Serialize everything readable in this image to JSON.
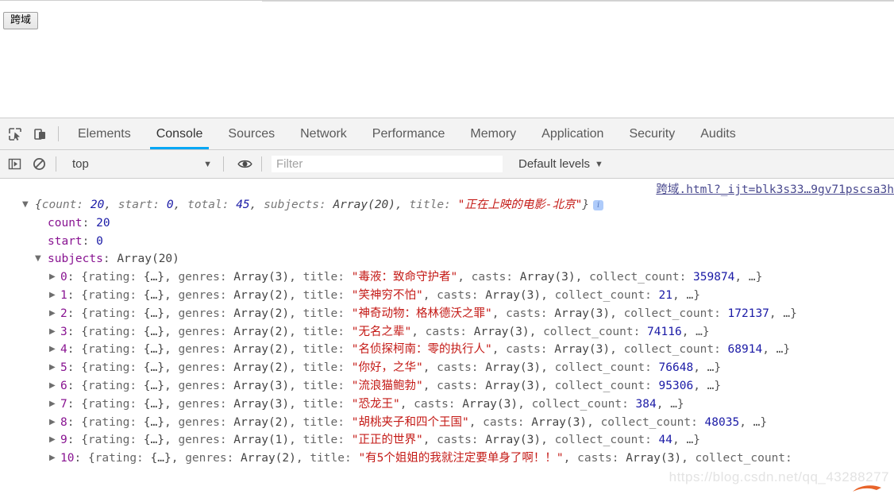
{
  "page": {
    "cors_button_label": "跨域"
  },
  "devtools": {
    "toolbar_icons": [
      {
        "name": "inspect-element-icon"
      },
      {
        "name": "device-toolbar-icon"
      }
    ],
    "tabs": [
      {
        "label": "Elements",
        "selected": false
      },
      {
        "label": "Console",
        "selected": true
      },
      {
        "label": "Sources",
        "selected": false
      },
      {
        "label": "Network",
        "selected": false
      },
      {
        "label": "Performance",
        "selected": false
      },
      {
        "label": "Memory",
        "selected": false
      },
      {
        "label": "Application",
        "selected": false
      },
      {
        "label": "Security",
        "selected": false
      },
      {
        "label": "Audits",
        "selected": false
      }
    ],
    "filterbar": {
      "sidebar_toggle_icon": "console-sidebar-icon",
      "clear_icon": "clear-console-icon",
      "context_value": "top",
      "caret": "▼",
      "eye_icon": "live-expression-eye-icon",
      "filter_placeholder": "Filter",
      "filter_value": "",
      "levels_label": "Default levels",
      "levels_caret": "▼"
    },
    "accent_color": "#06a7f5"
  },
  "console": {
    "source_link": "跨域.html?_ijt=blk3s33…9gv71pscsa3h",
    "root_preview": {
      "triangle": "▼",
      "text_open": "{",
      "entries": [
        {
          "key": "count",
          "sep": ": ",
          "value": "20",
          "kind": "num",
          "after": ", "
        },
        {
          "key": "start",
          "sep": ": ",
          "value": "0",
          "kind": "num",
          "after": ", "
        },
        {
          "key": "total",
          "sep": ": ",
          "value": "45",
          "kind": "num",
          "after": ", "
        },
        {
          "key": "subjects",
          "sep": ": ",
          "value": "Array(20)",
          "kind": "plain",
          "after": ", "
        },
        {
          "key": "title",
          "sep": ": ",
          "value": "\"正在上映的电影-北京\"",
          "kind": "str",
          "after": ""
        }
      ],
      "text_close": "}",
      "badge": "i"
    },
    "properties": [
      {
        "triangle": "",
        "key": "count",
        "value": "20",
        "kind": "num"
      },
      {
        "triangle": "",
        "key": "start",
        "value": "0",
        "kind": "num"
      },
      {
        "triangle": "▼",
        "key": "subjects",
        "value": "Array(20)",
        "kind": "plain"
      }
    ],
    "array_items": [
      {
        "index": "0",
        "rating": "{…}",
        "genres": "Array(3)",
        "title": "\"毒液：致命守护者\"",
        "casts": "Array(3)",
        "collect_count": "359874",
        "tail": ", …}"
      },
      {
        "index": "1",
        "rating": "{…}",
        "genres": "Array(2)",
        "title": "\"笑神穷不怕\"",
        "casts": "Array(3)",
        "collect_count": "21",
        "tail": ", …}"
      },
      {
        "index": "2",
        "rating": "{…}",
        "genres": "Array(2)",
        "title": "\"神奇动物：格林德沃之罪\"",
        "casts": "Array(3)",
        "collect_count": "172137",
        "tail": ", …}"
      },
      {
        "index": "3",
        "rating": "{…}",
        "genres": "Array(2)",
        "title": "\"无名之辈\"",
        "casts": "Array(3)",
        "collect_count": "74116",
        "tail": ", …}"
      },
      {
        "index": "4",
        "rating": "{…}",
        "genres": "Array(2)",
        "title": "\"名侦探柯南：零的执行人\"",
        "casts": "Array(3)",
        "collect_count": "68914",
        "tail": ", …}"
      },
      {
        "index": "5",
        "rating": "{…}",
        "genres": "Array(2)",
        "title": "\"你好，之华\"",
        "casts": "Array(3)",
        "collect_count": "76648",
        "tail": ", …}"
      },
      {
        "index": "6",
        "rating": "{…}",
        "genres": "Array(3)",
        "title": "\"流浪猫鲍勃\"",
        "casts": "Array(3)",
        "collect_count": "95306",
        "tail": ", …}"
      },
      {
        "index": "7",
        "rating": "{…}",
        "genres": "Array(3)",
        "title": "\"恐龙王\"",
        "casts": "Array(3)",
        "collect_count": "384",
        "tail": ", …}"
      },
      {
        "index": "8",
        "rating": "{…}",
        "genres": "Array(2)",
        "title": "\"胡桃夹子和四个王国\"",
        "casts": "Array(3)",
        "collect_count": "48035",
        "tail": ", …}"
      },
      {
        "index": "9",
        "rating": "{…}",
        "genres": "Array(1)",
        "title": "\"正正的世界\"",
        "casts": "Array(3)",
        "collect_count": "44",
        "tail": ", …}"
      },
      {
        "index": "10",
        "rating": "{…}",
        "genres": "Array(2)",
        "title": "\"有5个姐姐的我就注定要单身了啊！！\"",
        "casts": "Array(3)",
        "collect_count": "",
        "tail": ""
      }
    ],
    "labels": {
      "rating_key": "rating",
      "genres_key": "genres",
      "title_key": "title",
      "casts_key": "casts",
      "collect_key": "collect_count",
      "collapsed_triangle": "▶"
    }
  },
  "watermark": {
    "text": "https://blog.csdn.net/qq_43288277"
  }
}
